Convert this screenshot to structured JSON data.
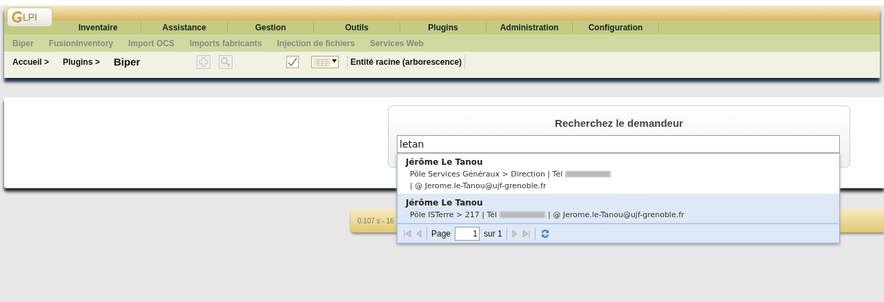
{
  "logo": {
    "text": "LPI"
  },
  "menu": [
    {
      "label": "Inventaire"
    },
    {
      "label": "Assistance"
    },
    {
      "label": "Gestion"
    },
    {
      "label": "Outils"
    },
    {
      "label": "Plugins"
    },
    {
      "label": "Administration"
    },
    {
      "label": "Configuration"
    }
  ],
  "submenu": [
    {
      "label": "Biper"
    },
    {
      "label": "FusionInventory"
    },
    {
      "label": "Import OCS"
    },
    {
      "label": "Imports fabricants"
    },
    {
      "label": "Injection de fichiers"
    },
    {
      "label": "Services Web"
    }
  ],
  "breadcrumb": {
    "items": [
      "Accueil >",
      "Plugins >"
    ],
    "current": "Biper"
  },
  "toolbar": {
    "add_disabled": true,
    "search_disabled": true
  },
  "entity": "Entité racine (arborescence)",
  "search_card": {
    "title": "Recherchez le demandeur",
    "value": "letan"
  },
  "results": [
    {
      "name": "Jérôme Le Tanou",
      "before_phone": "Pôle Services Généraux > Direction | Tél",
      "after_phone": "| @ Jerome.le-Tanou@ujf-grenoble.fr",
      "selected": false
    },
    {
      "name": "Jérôme Le Tanou",
      "before_phone": "Pôle ISTerre > 217 | Tél",
      "after_phone": "| @ Jerome.le-Tanou@ujf-grenoble.fr",
      "selected": true
    }
  ],
  "pager": {
    "label": "Page",
    "page": "1",
    "of": "sur 1"
  },
  "footer": {
    "text": "0.107 s - 16"
  }
}
